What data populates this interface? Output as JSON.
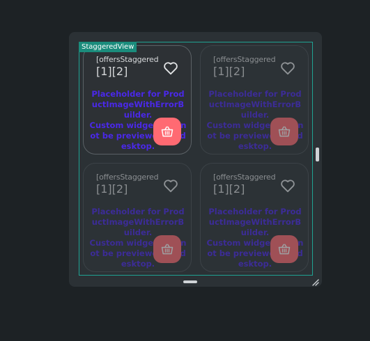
{
  "frame": {
    "label": "StaggeredView"
  },
  "cards": [
    {
      "title_line1": "[offersStaggered",
      "title_line2": "[1][2]",
      "placeholder": "Placeholder for ProductImageWithErrorBuilder.\nCustom widgets cannot be previewed on desktop."
    },
    {
      "title_line1": "[offersStaggered",
      "title_line2": "[1][2]",
      "placeholder": "Placeholder for ProductImageWithErrorBuilder.\nCustom widgets cannot be previewed on desktop."
    },
    {
      "title_line1": "[offersStaggered",
      "title_line2": "[1][2]",
      "placeholder": "Placeholder for ProductImageWithErrorBuilder.\nCustom widgets cannot be previewed on desktop."
    },
    {
      "title_line1": "[offersStaggered",
      "title_line2": "[1][2]",
      "placeholder": "Placeholder for ProductImageWithErrorBuilder.\nCustom widgets cannot be previewed on desktop."
    }
  ],
  "icons": {
    "favorite": "heart-outline-icon",
    "basket": "shopping-basket-icon",
    "resize": "resize-handle-icon"
  },
  "colors": {
    "frame_outline": "#1fa393",
    "placeholder_text": "#4a28e8",
    "basket_button": "#ff6a72"
  }
}
